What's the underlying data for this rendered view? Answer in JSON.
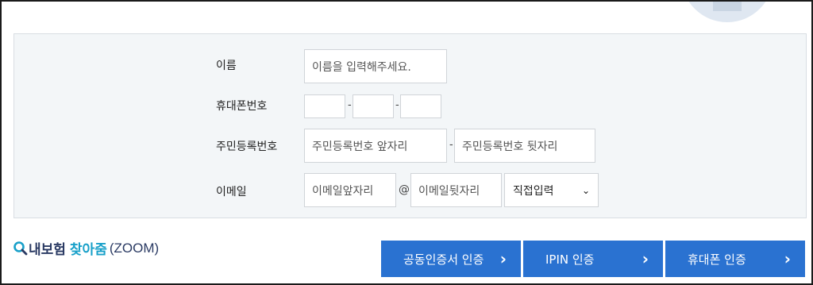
{
  "form": {
    "name_label": "이름",
    "name_placeholder": "이름을 입력해주세요.",
    "phone_label": "휴대폰번호",
    "phone_sep1": "-",
    "phone_sep2": "-",
    "rrn_label": "주민등록번호",
    "rrn_front_placeholder": "주민등록번호 앞자리",
    "rrn_sep": "-",
    "rrn_back_placeholder": "주민등록번호 뒷자리",
    "email_label": "이메일",
    "email_front_placeholder": "이메일앞자리",
    "email_at": "@",
    "email_back_placeholder": "이메일뒷자리",
    "email_domain_select": "직접입력"
  },
  "brand": {
    "part1": "내보험",
    "part2": "찾아줌",
    "part3": "(ZOOM)"
  },
  "buttons": {
    "cert_label": "공동인증서 인증",
    "ipin_label": "IPIN 인증",
    "phone_label": "휴대폰 인증"
  },
  "colors": {
    "button_bg": "#2a72d1",
    "panel_bg": "#f3f6f8",
    "brand_navy": "#2a3a63",
    "brand_cyan": "#18a0c9"
  }
}
